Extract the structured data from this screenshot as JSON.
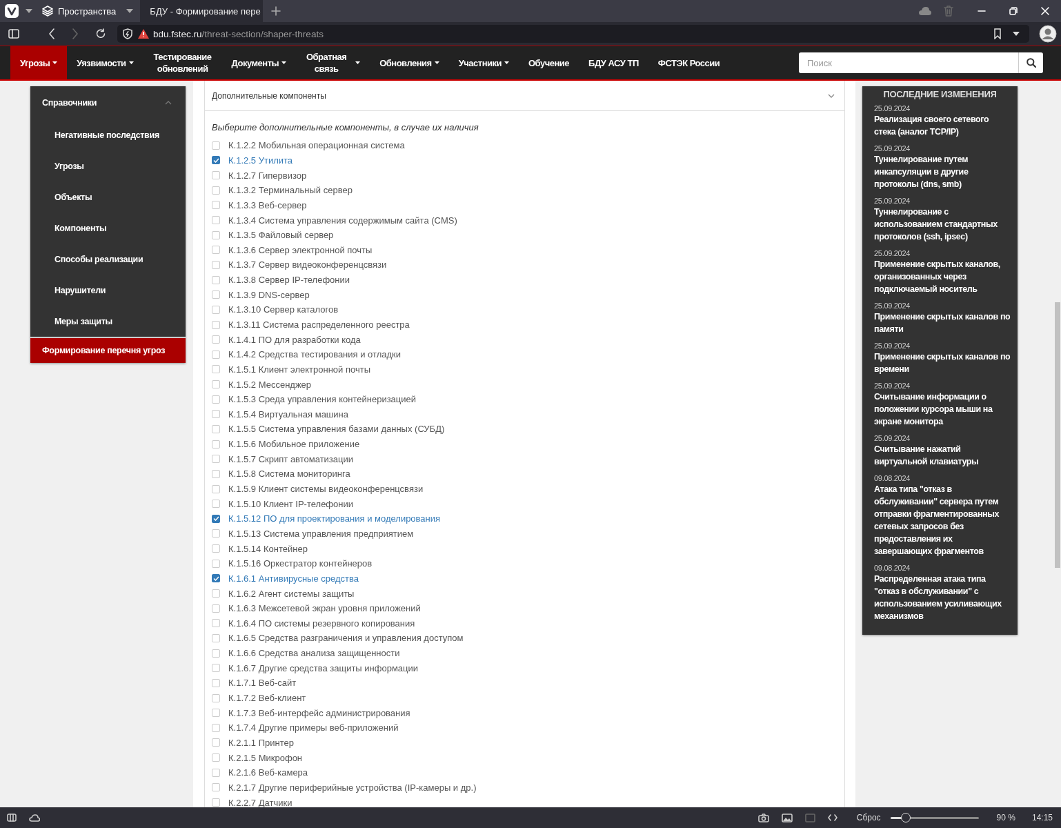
{
  "browser": {
    "workspaces_label": "Пространства",
    "tabs": [
      {
        "title": "БДУ - Формирование пере",
        "selected": true
      }
    ],
    "url_host": "bdu.fstec.ru",
    "url_path": "/threat-section/shaper-threats"
  },
  "nav": {
    "items": [
      {
        "label": "Угрозы",
        "dropdown": true,
        "selected": true
      },
      {
        "label": "Уязвимости",
        "dropdown": true,
        "selected": false
      },
      {
        "label": "Тестирование обновлений",
        "dropdown": false,
        "selected": false
      },
      {
        "label": "Документы",
        "dropdown": true,
        "selected": false
      },
      {
        "label": "Обратная связь",
        "dropdown": true,
        "selected": false
      },
      {
        "label": "Обновления",
        "dropdown": true,
        "selected": false
      },
      {
        "label": "Участники",
        "dropdown": true,
        "selected": false
      },
      {
        "label": "Обучение",
        "dropdown": false,
        "selected": false
      },
      {
        "label": "БДУ АСУ ТП",
        "dropdown": false,
        "selected": false
      },
      {
        "label": "ФСТЭК России",
        "dropdown": false,
        "selected": false
      }
    ],
    "search": {
      "placeholder": "Поиск"
    }
  },
  "sidebar": {
    "title": "Справочники",
    "expanded": true,
    "items": [
      {
        "label": "Негативные последствия",
        "selected": false
      },
      {
        "label": "Угрозы",
        "selected": false
      },
      {
        "label": "Объекты",
        "selected": false
      },
      {
        "label": "Компоненты",
        "selected": false
      },
      {
        "label": "Способы реализации",
        "selected": false
      },
      {
        "label": "Нарушители",
        "selected": false
      },
      {
        "label": "Меры защиты",
        "selected": false
      }
    ],
    "footer_item": {
      "label": "Формирование перечня угроз",
      "selected": true
    }
  },
  "panel": {
    "title": "Дополнительные компоненты",
    "expanded": true,
    "prompt": "Выберите дополнительные компоненты, в случае их наличия",
    "options": [
      {
        "label": "К.1.2.2 Мобильная операционная система",
        "checked": false
      },
      {
        "label": "К.1.2.5 Утилита",
        "checked": true
      },
      {
        "label": "К.1.2.7 Гипервизор",
        "checked": false
      },
      {
        "label": "К.1.3.2 Терминальный сервер",
        "checked": false
      },
      {
        "label": "К.1.3.3 Веб-сервер",
        "checked": false
      },
      {
        "label": "К.1.3.4 Система управления содержимым сайта (CMS)",
        "checked": false
      },
      {
        "label": "К.1.3.5 Файловый сервер",
        "checked": false
      },
      {
        "label": "К.1.3.6 Сервер электронной почты",
        "checked": false
      },
      {
        "label": "К.1.3.7 Сервер видеоконференцсвязи",
        "checked": false
      },
      {
        "label": "К.1.3.8 Сервер IP-телефонии",
        "checked": false
      },
      {
        "label": "К.1.3.9 DNS-сервер",
        "checked": false
      },
      {
        "label": "К.1.3.10 Сервер каталогов",
        "checked": false
      },
      {
        "label": "К.1.3.11 Система распределенного реестра",
        "checked": false
      },
      {
        "label": "К.1.4.1 ПО для разработки кода",
        "checked": false
      },
      {
        "label": "К.1.4.2 Средства тестирования и отладки",
        "checked": false
      },
      {
        "label": "К.1.5.1 Клиент электронной почты",
        "checked": false
      },
      {
        "label": "К.1.5.2 Мессенджер",
        "checked": false
      },
      {
        "label": "К.1.5.3 Среда управления контейнеризацией",
        "checked": false
      },
      {
        "label": "К.1.5.4 Виртуальная машина",
        "checked": false
      },
      {
        "label": "К.1.5.5 Система управления базами данных (СУБД)",
        "checked": false
      },
      {
        "label": "К.1.5.6 Мобильное приложение",
        "checked": false
      },
      {
        "label": "К.1.5.7 Скрипт автоматизации",
        "checked": false
      },
      {
        "label": "К.1.5.8 Система мониторинга",
        "checked": false
      },
      {
        "label": "К.1.5.9 Клиент системы видеоконференцсвязи",
        "checked": false
      },
      {
        "label": "К.1.5.10 Клиент IP-телефонии",
        "checked": false
      },
      {
        "label": "К.1.5.12 ПО для проектирования и моделирования",
        "checked": true
      },
      {
        "label": "К.1.5.13 Система управления предприятием",
        "checked": false
      },
      {
        "label": "К.1.5.14 Контейнер",
        "checked": false
      },
      {
        "label": "К.1.5.16 Оркестратор контейнеров",
        "checked": false
      },
      {
        "label": "К.1.6.1 Антивирусные средства",
        "checked": true
      },
      {
        "label": "К.1.6.2 Агент системы защиты",
        "checked": false
      },
      {
        "label": "К.1.6.3 Межсетевой экран уровня приложений",
        "checked": false
      },
      {
        "label": "К.1.6.4 ПО системы резервного копирования",
        "checked": false
      },
      {
        "label": "К.1.6.5 Средства разграничения и управления доступом",
        "checked": false
      },
      {
        "label": "К.1.6.6 Средства анализа защищенности",
        "checked": false
      },
      {
        "label": "К.1.6.7 Другие средства защиты информации",
        "checked": false
      },
      {
        "label": "К.1.7.1 Веб-сайт",
        "checked": false
      },
      {
        "label": "К.1.7.2 Веб-клиент",
        "checked": false
      },
      {
        "label": "К.1.7.3 Веб-интерфейс администрирования",
        "checked": false
      },
      {
        "label": "К.1.7.4 Другие примеры веб-приложений",
        "checked": false
      },
      {
        "label": "К.2.1.1 Принтер",
        "checked": false
      },
      {
        "label": "К.2.1.5 Микрофон",
        "checked": false
      },
      {
        "label": "К.2.1.6 Веб-камера",
        "checked": false
      },
      {
        "label": "К.2.1.7 Другие периферийные устройства (IP-камеры и др.)",
        "checked": false
      },
      {
        "label": "К.2.2.7 Датчики",
        "checked": false
      }
    ]
  },
  "recent": {
    "title": "ПОСЛЕДНИЕ ИЗМЕНЕНИЯ",
    "items": [
      {
        "date": "25.09.2024",
        "title": "Реализация своего сетевого стека (аналог TCP/IP)"
      },
      {
        "date": "25.09.2024",
        "title": "Туннелирование путем инкапсуляции в другие протоколы (dns, smb)"
      },
      {
        "date": "25.09.2024",
        "title": "Туннелирование с использованием стандартных протоколов (ssh, ipsec)"
      },
      {
        "date": "25.09.2024",
        "title": "Применение скрытых каналов, организованных через подключаемый носитель"
      },
      {
        "date": "25.09.2024",
        "title": "Применение скрытых каналов по памяти"
      },
      {
        "date": "25.09.2024",
        "title": "Применение скрытых каналов по времени"
      },
      {
        "date": "25.09.2024",
        "title": "Считывание информации о положении курсора мыши на экране монитора"
      },
      {
        "date": "25.09.2024",
        "title": "Считывание нажатий виртуальной клавиатуры"
      },
      {
        "date": "09.08.2024",
        "title": "Атака типа \"отказ в обслуживании\" сервера путем отправки фрагментированных сетевых запросов без предоставления их завершающих фрагментов"
      },
      {
        "date": "09.08.2024",
        "title": "Распределенная атака типа \"отказ в обслуживании\" с использованием усиливающих механизмов"
      }
    ]
  },
  "status_bar": {
    "reset_label": "Сброс",
    "zoom": {
      "level": 0.18
    },
    "zoom_text": "90 %",
    "clock": "14:15"
  }
}
